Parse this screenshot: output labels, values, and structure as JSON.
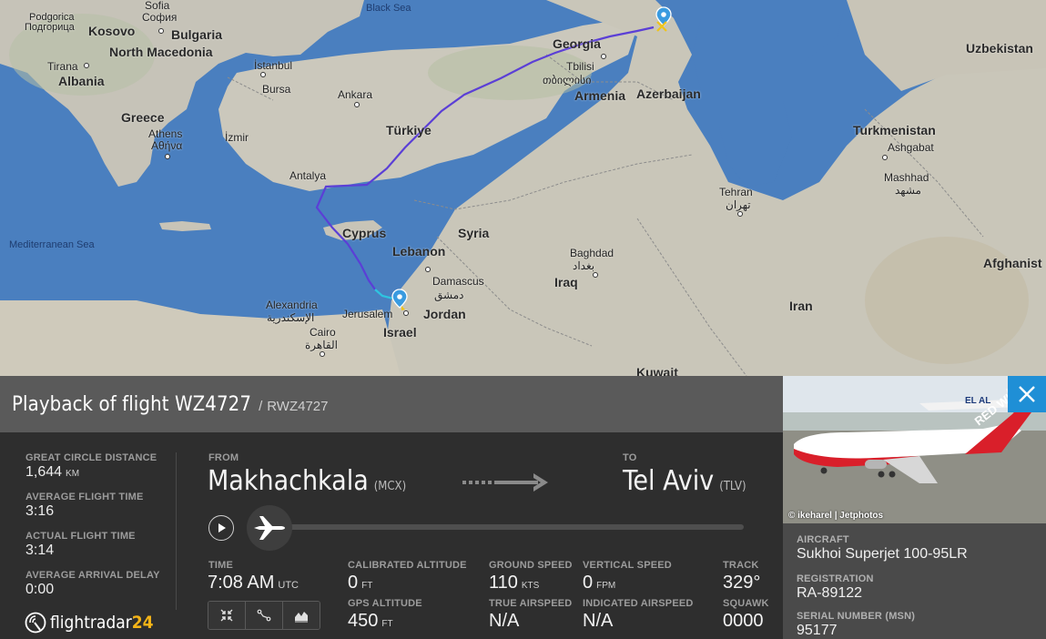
{
  "map": {
    "seas": [
      {
        "name": "Black Sea"
      },
      {
        "name": "Mediterranean Sea"
      }
    ],
    "countries": [
      "Bulgaria",
      "North Macedonia",
      "Kosovo",
      "Albania",
      "Greece",
      "Georgia",
      "Armenia",
      "Azerbaijan",
      "Türkiye",
      "Uzbekistan",
      "Turkmenistan",
      "Cyprus",
      "Syria",
      "Lebanon",
      "Iraq",
      "Iran",
      "Israel",
      "Jordan",
      "Afghanist",
      "Kuwait"
    ],
    "cities": [
      "Sofia",
      "София",
      "Podgorica",
      "Подгорица",
      "Tirana",
      "İstanbul",
      "Bursa",
      "Ankara",
      "Athens",
      "Αθήνα",
      "İzmir",
      "Antalya",
      "Tbilisi",
      "თბილისი",
      "Ashgabat",
      "Mashhad",
      "مشهد",
      "Tehran",
      "تهران",
      "Baghdad",
      "بغداد",
      "Damascus",
      "دمشق",
      "Alexandria",
      "الإسكندرية",
      "Cairo",
      "القاهرة",
      "Jerusalem"
    ]
  },
  "flight": {
    "title": "Playback of flight WZ4727",
    "separator": "/",
    "callsign": "RWZ4727"
  },
  "stats": {
    "great_circle_label": "GREAT CIRCLE DISTANCE",
    "great_circle_value": "1,644",
    "great_circle_unit": "KM",
    "avg_flight_time_label": "AVERAGE FLIGHT TIME",
    "avg_flight_time_value": "3:16",
    "actual_flight_time_label": "ACTUAL FLIGHT TIME",
    "actual_flight_time_value": "3:14",
    "avg_arrival_delay_label": "AVERAGE ARRIVAL DELAY",
    "avg_arrival_delay_value": "0:00"
  },
  "route": {
    "from_label": "FROM",
    "from_city": "Makhachkala",
    "from_code": "(MCX)",
    "to_label": "TO",
    "to_city": "Tel Aviv",
    "to_code": "(TLV)"
  },
  "playback": {
    "progress": 0.0
  },
  "telemetry": {
    "time_label": "TIME",
    "time_value": "7:08 AM",
    "time_unit": "UTC",
    "cal_alt_label": "CALIBRATED ALTITUDE",
    "cal_alt_value": "0",
    "cal_alt_unit": "FT",
    "gps_alt_label": "GPS ALTITUDE",
    "gps_alt_value": "450",
    "gps_alt_unit": "FT",
    "ground_speed_label": "GROUND SPEED",
    "ground_speed_value": "110",
    "ground_speed_unit": "KTS",
    "true_airspeed_label": "TRUE AIRSPEED",
    "true_airspeed_value": "N/A",
    "vertical_speed_label": "VERTICAL SPEED",
    "vertical_speed_value": "0",
    "vertical_speed_unit": "FPM",
    "indicated_airspeed_label": "INDICATED AIRSPEED",
    "indicated_airspeed_value": "N/A",
    "track_label": "TRACK",
    "track_value": "329°",
    "squawk_label": "SQUAWK",
    "squawk_value": "0000"
  },
  "logo": {
    "text": "flightradar",
    "number": "24"
  },
  "aircraft": {
    "photo_credit": "© ikeharel | Jetphotos",
    "aircraft_label": "AIRCRAFT",
    "aircraft_value": "Sukhoi Superjet 100-95LR",
    "registration_label": "REGISTRATION",
    "registration_value": "RA-89122",
    "serial_label": "SERIAL NUMBER (MSN)",
    "serial_value": "95177"
  },
  "colors": {
    "map_sea": "#4a7fbf",
    "land": "#c9c6bb",
    "track_main": "#5b3fd6",
    "accent_blue": "#1f8fd6",
    "logo_yellow": "#f5b417"
  },
  "icons": {
    "play": "play-icon",
    "plane": "airplane-icon",
    "close": "close-icon",
    "tool1": "collapse-arrows-icon",
    "tool2": "route-nodes-icon",
    "tool3": "area-chart-icon"
  }
}
